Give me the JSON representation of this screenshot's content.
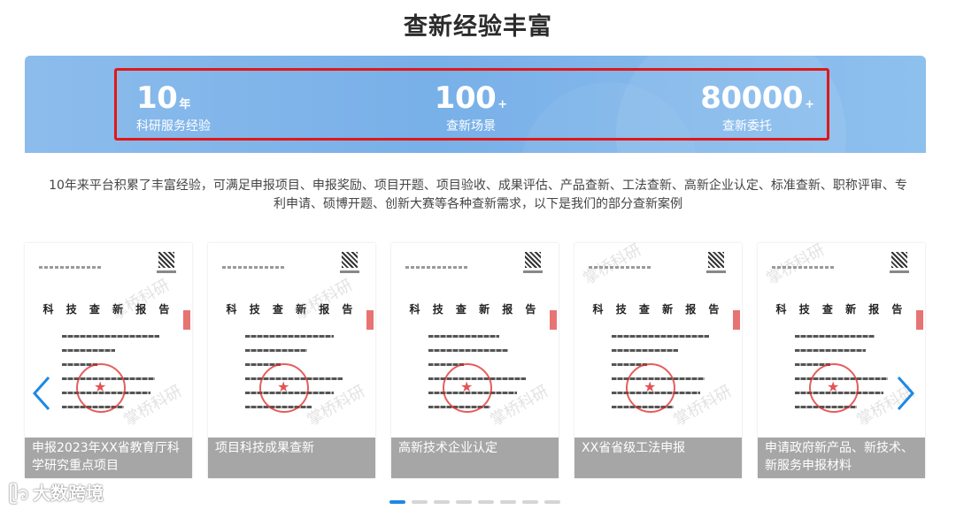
{
  "page_title": "查新经验丰富",
  "stats": [
    {
      "number": "10",
      "unit": "年",
      "label": "科研服务经验"
    },
    {
      "number": "100",
      "unit": "+",
      "label": "查新场景"
    },
    {
      "number": "80000",
      "unit": "+",
      "label": "查新委托"
    }
  ],
  "intro_line1": "10年来平台积累了丰富经验，可满足申报项目、申报奖励、项目开题、项目验收、成果评估、产品查新、工法查新、高新企业认定、标准查新、职称评审、专",
  "intro_line2": "利申请、硕博开题、创新大赛等各种查新需求，以下是我们的部分查新案例",
  "report_title": "科 技 查 新 报 告",
  "watermark": "掌桥科研",
  "cards": [
    {
      "caption_1": "申报2023年XX省教育厅科",
      "caption_2": "学研究重点项目"
    },
    {
      "caption_1": "项目科技成果查新",
      "caption_2": ""
    },
    {
      "caption_1": "高新技术企业认定",
      "caption_2": ""
    },
    {
      "caption_1": "XX省省级工法申报",
      "caption_2": ""
    },
    {
      "caption_1": "申请政府新产品、新技术、",
      "caption_2": "新服务申报材料"
    }
  ],
  "brand": "大数跨境",
  "colors": {
    "accent": "#1e88e5",
    "highlight_frame": "#e01818",
    "banner": "#7fb4ea",
    "caption_bg": "#969696"
  }
}
